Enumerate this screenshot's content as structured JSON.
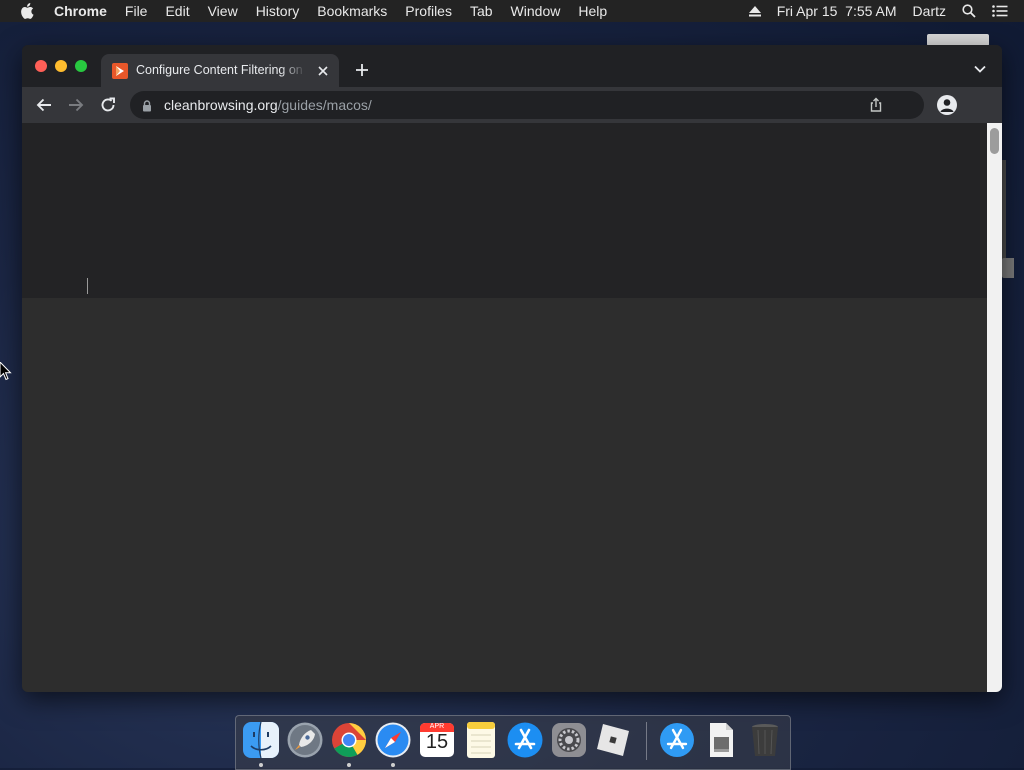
{
  "menubar": {
    "app_name": "Chrome",
    "menus": [
      "File",
      "Edit",
      "View",
      "History",
      "Bookmarks",
      "Profiles",
      "Tab",
      "Window",
      "Help"
    ],
    "datetime": "Fri Apr 15  7:55 AM",
    "user": "Dartz",
    "icons": [
      "apple-icon",
      "eject-icon",
      "spotlight-search-icon",
      "control-center-list-icon"
    ]
  },
  "browser": {
    "tab": {
      "title": "Configure Content Filtering on macOS",
      "favicon": "cleanbrowsing-favicon"
    },
    "omnibox": {
      "host": "cleanbrowsing.org",
      "path": "/guides/macos/"
    },
    "toolbar_icons": [
      "back-arrow-icon",
      "forward-arrow-icon",
      "reload-icon",
      "lock-icon",
      "share-icon",
      "profile-avatar-icon"
    ],
    "page": {
      "status": "blank-loading-dark"
    }
  },
  "dock": {
    "calendar": {
      "month": "APR",
      "day": "15"
    },
    "items": [
      {
        "name": "Finder",
        "icon": "finder-icon",
        "running": true
      },
      {
        "name": "Launchpad",
        "icon": "launchpad-icon",
        "running": false
      },
      {
        "name": "Google Chrome",
        "icon": "chrome-icon",
        "running": true
      },
      {
        "name": "Safari",
        "icon": "safari-icon",
        "running": true
      },
      {
        "name": "Calendar",
        "icon": "calendar-icon",
        "running": false
      },
      {
        "name": "Notes",
        "icon": "notes-icon",
        "running": false
      },
      {
        "name": "App Store",
        "icon": "app-store-icon",
        "running": false
      },
      {
        "name": "System Preferences",
        "icon": "system-preferences-icon",
        "running": false
      },
      {
        "name": "Roblox",
        "icon": "roblox-icon",
        "running": false
      },
      {
        "name": "App Store Downloads",
        "icon": "app-store-folder-icon",
        "running": false
      },
      {
        "name": "Document",
        "icon": "document-icon",
        "running": false
      },
      {
        "name": "Trash",
        "icon": "trash-icon",
        "running": false
      }
    ]
  },
  "colors": {
    "menubar_bg": "#232323",
    "tab_bg": "#35363a",
    "window_bg": "#202124",
    "page_bg": "#2d2d2d",
    "close_red": "#ff5f57",
    "minimize_yellow": "#febc2e",
    "zoom_green": "#28c840"
  }
}
